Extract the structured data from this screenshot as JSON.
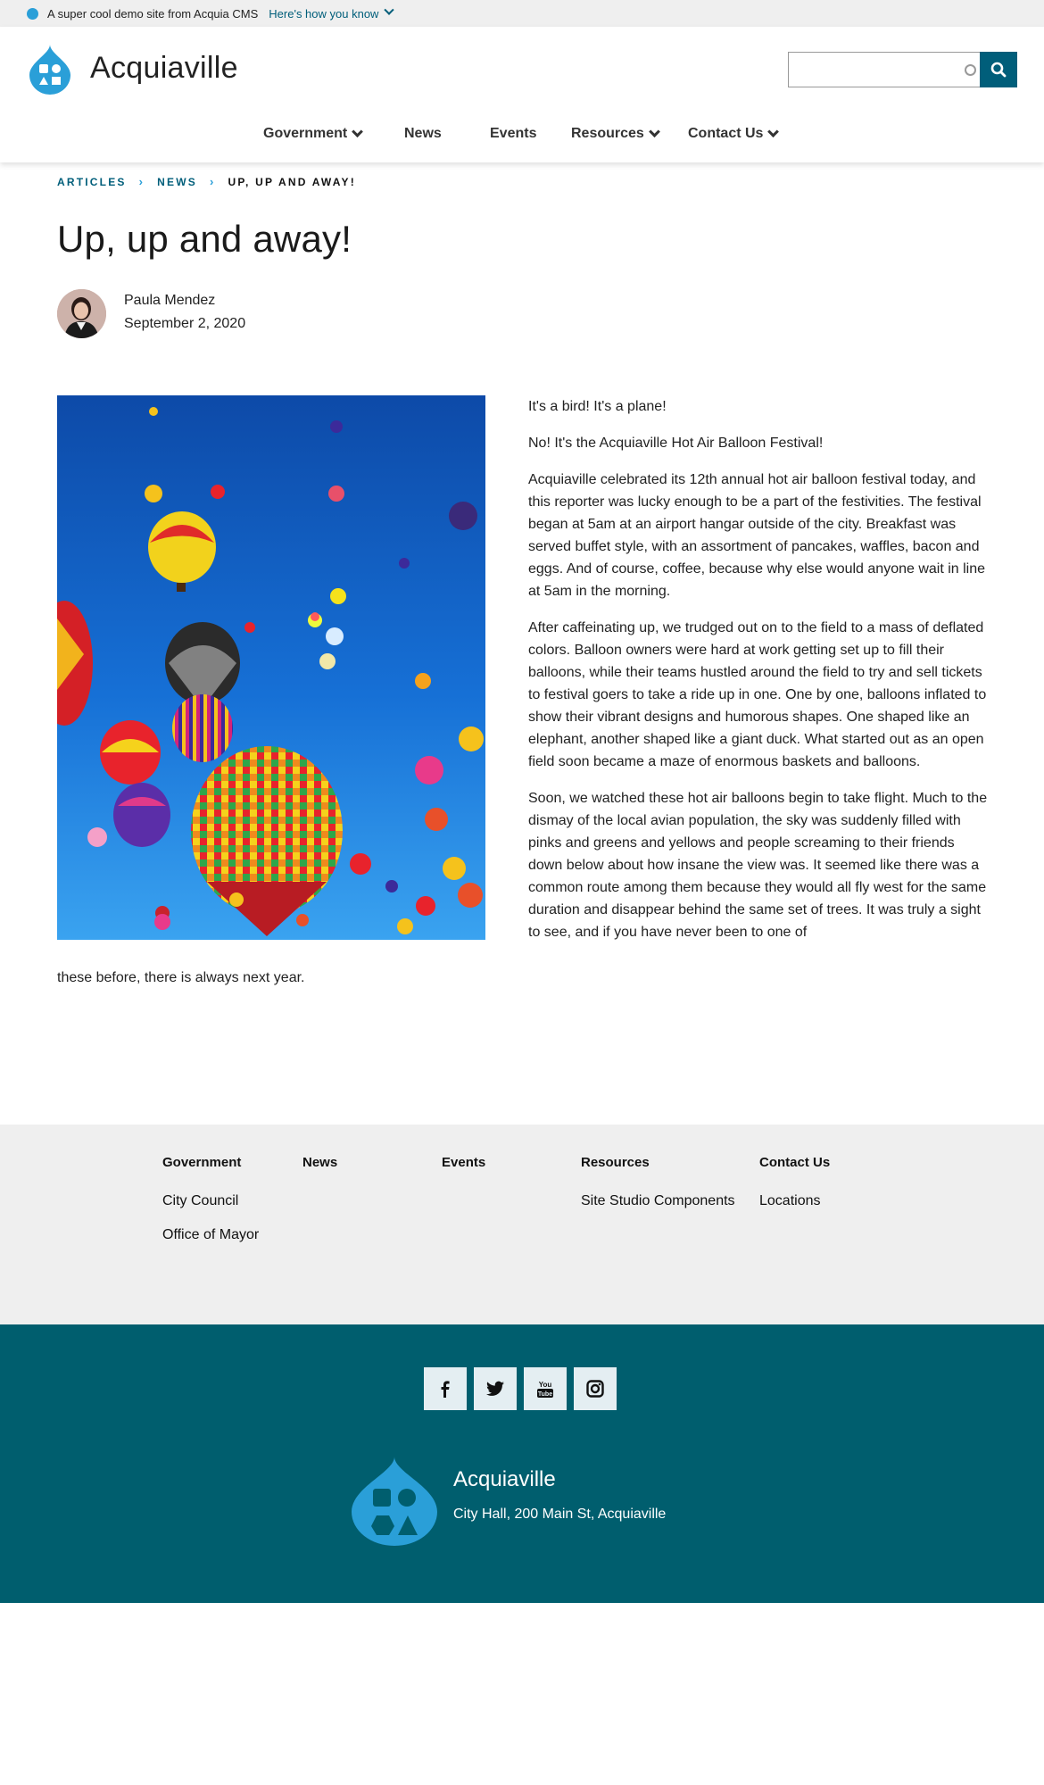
{
  "banner": {
    "text": "A super cool demo site from Acquia CMS",
    "link": "Here's how you know"
  },
  "header": {
    "site_name": "Acquiaville",
    "search_placeholder": "",
    "nav": [
      {
        "label": "Government",
        "has_dropdown": true
      },
      {
        "label": "News",
        "has_dropdown": false
      },
      {
        "label": "Events",
        "has_dropdown": false
      },
      {
        "label": "Resources",
        "has_dropdown": true
      },
      {
        "label": "Contact Us",
        "has_dropdown": true
      }
    ]
  },
  "breadcrumb": [
    "ARTICLES",
    "NEWS",
    "UP, UP AND AWAY!"
  ],
  "article": {
    "title": "Up, up and away!",
    "author": "Paula Mendez",
    "date": "September 2, 2020",
    "paragraphs": [
      "It's a bird! It's a plane!",
      "No! It's the Acquiaville Hot Air Balloon Festival!",
      "Acquiaville celebrated its 12th annual hot air balloon festival today, and this reporter was lucky enough to be a part of the festivities. The festival began at 5am at an airport hangar outside of the city. Breakfast was served buffet style, with an assortment of pancakes, waffles, bacon and eggs. And of course, coffee, because why else would anyone wait in line at 5am in the morning.",
      "After caffeinating up, we trudged out on to the field to a mass of deflated colors. Balloon owners were hard at work getting set up to fill their balloons, while their teams hustled around the field to try and sell tickets to festival goers to take a ride up in one. One by one, balloons inflated to show their vibrant designs and humorous shapes. One shaped like an elephant, another shaped like a giant duck. What started out as an open field soon became a maze of enormous baskets and balloons.",
      "Soon, we watched these hot air balloons begin to take flight. Much to the dismay of the local avian population, the sky was suddenly filled with pinks and greens and yellows and people screaming to their friends down below about how insane the view was. It seemed like there was a common route among them because they would all fly west for the same duration and disappear behind the same set of trees. It was truly a sight to see, and if you have never been to one of"
    ],
    "paragraph_tail": "these before, there is always next year."
  },
  "footer_menu": [
    {
      "heading": "Government",
      "links": [
        "City Council",
        "Office of Mayor"
      ]
    },
    {
      "heading": "News",
      "links": []
    },
    {
      "heading": "Events",
      "links": []
    },
    {
      "heading": "Resources",
      "links": [
        "Site Studio Components"
      ]
    },
    {
      "heading": "Contact Us",
      "links": [
        "Locations"
      ]
    }
  ],
  "footer": {
    "social": [
      "facebook-icon",
      "twitter-icon",
      "youtube-icon",
      "instagram-icon"
    ],
    "site_name": "Acquiaville",
    "address": "City Hall, 200 Main St, Acquiaville"
  },
  "colors": {
    "brand_blue": "#2a9fd8",
    "dark_teal": "#005e6e",
    "link_teal": "#005e7a",
    "footer_menu_bg": "#efefef"
  }
}
